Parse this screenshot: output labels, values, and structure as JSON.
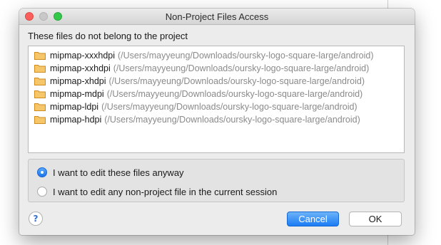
{
  "window": {
    "title": "Non-Project Files Access"
  },
  "header": {
    "label": "These files do not belong to the project"
  },
  "files": [
    {
      "name": "mipmap-xxxhdpi",
      "path": "(/Users/mayyeung/Downloads/oursky-logo-square-large/android)"
    },
    {
      "name": "mipmap-xxhdpi",
      "path": "(/Users/mayyeung/Downloads/oursky-logo-square-large/android)"
    },
    {
      "name": "mipmap-xhdpi",
      "path": "(/Users/mayyeung/Downloads/oursky-logo-square-large/android)"
    },
    {
      "name": "mipmap-mdpi",
      "path": "(/Users/mayyeung/Downloads/oursky-logo-square-large/android)"
    },
    {
      "name": "mipmap-ldpi",
      "path": "(/Users/mayyeung/Downloads/oursky-logo-square-large/android)"
    },
    {
      "name": "mipmap-hdpi",
      "path": "(/Users/mayyeung/Downloads/oursky-logo-square-large/android)"
    }
  ],
  "options": [
    {
      "label": "I want to edit these files anyway",
      "selected": true
    },
    {
      "label": "I want to edit any non-project file in the current session",
      "selected": false
    }
  ],
  "buttons": {
    "help_label": "?",
    "cancel_label": "Cancel",
    "ok_label": "OK"
  },
  "colors": {
    "accent": "#1b7cf3",
    "close": "#fc605c",
    "maximize": "#34c84a",
    "folder": "#e8a33d"
  },
  "icons": {
    "file": "folder-icon",
    "help": "help-icon"
  }
}
